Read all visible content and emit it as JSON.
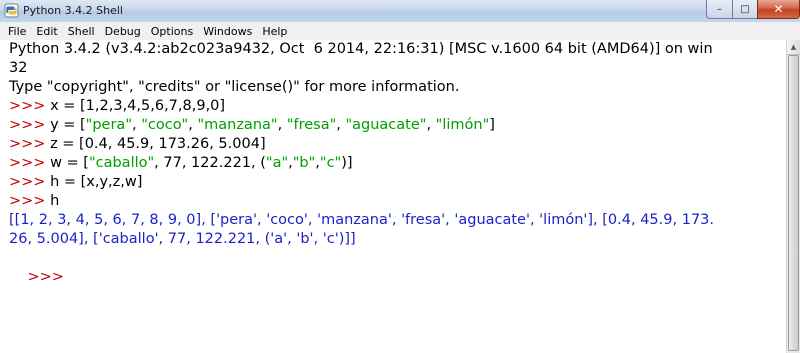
{
  "window": {
    "title": "Python 3.4.2 Shell",
    "minimize_glyph": "–",
    "maximize_glyph": "□",
    "close_glyph": "✕"
  },
  "menu": {
    "items": [
      "File",
      "Edit",
      "Shell",
      "Debug",
      "Options",
      "Windows",
      "Help"
    ]
  },
  "shell": {
    "prompt": ">>> ",
    "banner": [
      "Python 3.4.2 (v3.4.2:ab2c023a9432, Oct  6 2014, 22:16:31) [MSC v.1600 64 bit (AMD64)] on win",
      "32",
      "Type \"copyright\", \"credits\" or \"license()\" for more information."
    ],
    "commands": [
      {
        "segments": [
          {
            "t": "x = [1,2,3,4,5,6,7,8,9,0]",
            "k": "code"
          }
        ]
      },
      {
        "segments": [
          {
            "t": "y = [",
            "k": "code"
          },
          {
            "t": "\"pera\"",
            "k": "str"
          },
          {
            "t": ", ",
            "k": "code"
          },
          {
            "t": "\"coco\"",
            "k": "str"
          },
          {
            "t": ", ",
            "k": "code"
          },
          {
            "t": "\"manzana\"",
            "k": "str"
          },
          {
            "t": ", ",
            "k": "code"
          },
          {
            "t": "\"fresa\"",
            "k": "str"
          },
          {
            "t": ", ",
            "k": "code"
          },
          {
            "t": "\"aguacate\"",
            "k": "str"
          },
          {
            "t": ", ",
            "k": "code"
          },
          {
            "t": "\"limón\"",
            "k": "str"
          },
          {
            "t": "]",
            "k": "code"
          }
        ]
      },
      {
        "segments": [
          {
            "t": "z = [0.4, 45.9, 173.26, 5.004]",
            "k": "code"
          }
        ]
      },
      {
        "segments": [
          {
            "t": "w = [",
            "k": "code"
          },
          {
            "t": "\"caballo\"",
            "k": "str"
          },
          {
            "t": ", 77, 122.221, (",
            "k": "code"
          },
          {
            "t": "\"a\"",
            "k": "str"
          },
          {
            "t": ",",
            "k": "code"
          },
          {
            "t": "\"b\"",
            "k": "str"
          },
          {
            "t": ",",
            "k": "code"
          },
          {
            "t": "\"c\"",
            "k": "str"
          },
          {
            "t": ")]",
            "k": "code"
          }
        ]
      },
      {
        "segments": [
          {
            "t": "h = [x,y,z,w]",
            "k": "code"
          }
        ]
      },
      {
        "segments": [
          {
            "t": "h",
            "k": "code"
          }
        ]
      }
    ],
    "result": [
      "[[1, 2, 3, 4, 5, 6, 7, 8, 9, 0], ['pera', 'coco', 'manzana', 'fresa', 'aguacate', 'limón'], [0.4, 45.9, 173.",
      "26, 5.004], ['caballo', 77, 122.221, ('a', 'b', 'c')]]"
    ]
  },
  "colors": {
    "prompt": "#c00000",
    "string": "#00a000",
    "output": "#1b23c8",
    "text": "#000000"
  }
}
